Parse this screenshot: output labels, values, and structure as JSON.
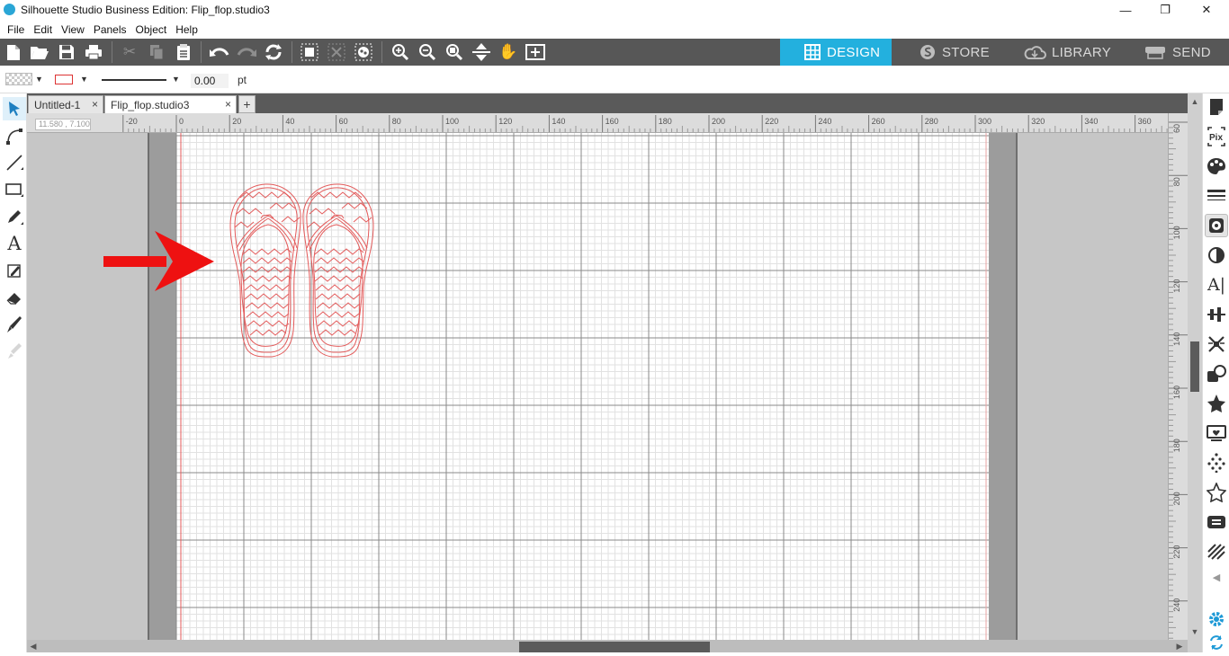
{
  "window": {
    "title": "Silhouette Studio Business Edition: Flip_flop.studio3",
    "controls": [
      "minimize",
      "restore",
      "close"
    ]
  },
  "menu": [
    "File",
    "Edit",
    "View",
    "Panels",
    "Object",
    "Help"
  ],
  "toolbar": {
    "file_icons": [
      "new-document-icon",
      "open-folder-icon",
      "save-icon",
      "print-icon"
    ],
    "edit_icons": [
      "cut-icon",
      "copy-icon",
      "paste-icon"
    ],
    "history_icons": [
      "undo-icon",
      "redo-icon",
      "redraw-icon"
    ],
    "group_icons": [
      "select-all-icon",
      "deselect-icon",
      "edit-points-icon"
    ],
    "zoom_icons": [
      "zoom-in-icon",
      "zoom-out-icon",
      "zoom-selection-icon",
      "fit-page-icon",
      "pan-hand-icon",
      "fit-to-window-icon"
    ],
    "nav_tabs": [
      {
        "label": "DESIGN",
        "icon": "grid-icon",
        "active": true
      },
      {
        "label": "STORE",
        "icon": "silhouette-s-icon",
        "active": false
      },
      {
        "label": "LIBRARY",
        "icon": "cloud-icon",
        "active": false
      },
      {
        "label": "SEND",
        "icon": "cutter-icon",
        "active": false
      }
    ],
    "active_color": "#23b0de"
  },
  "properties": {
    "fill_swatch": "transparent-checker",
    "line_color": "#dd3333",
    "line_weight": "0.00",
    "line_unit": "pt"
  },
  "left_tools": [
    "select-icon",
    "edit-points-icon",
    "line-icon",
    "rectangle-icon",
    "freehand-icon",
    "text-icon",
    "sketch-pen-icon",
    "eraser-icon",
    "knife-icon",
    "eyedropper-icon"
  ],
  "doc_tabs": [
    {
      "label": "Untitled-1",
      "active": false
    },
    {
      "label": "Flip_flop.studio3",
      "active": true
    }
  ],
  "add_tab_label": "+",
  "ruler": {
    "coord_readout": "11.580 , 7.100",
    "h_labels": [
      "-20",
      "0",
      "20",
      "40",
      "60",
      "80",
      "100",
      "120",
      "140",
      "160",
      "180",
      "200",
      "220",
      "240",
      "260",
      "280",
      "300",
      "320",
      "340",
      "360"
    ],
    "v_labels": [
      "60",
      "80",
      "100",
      "120",
      "140",
      "160",
      "180",
      "200",
      "220",
      "240"
    ]
  },
  "canvas": {
    "design_color": "#e35a5a",
    "annotation_arrow_color": "#ee1111",
    "objects": [
      "left-flip-flop",
      "right-flip-flop"
    ]
  },
  "right_panel": [
    "page-setup-icon",
    "pixscan-icon",
    "fill-panel-icon",
    "line-style-icon",
    "trace-icon",
    "transparency-icon",
    "text-style-icon",
    "align-icon",
    "replicate-icon",
    "modify-icon",
    "offset-icon",
    "transform-icon",
    "design-store-icon",
    "rhinestone-icon",
    "sketch-icon",
    "emboss-icon",
    "nesting-icon",
    "settings-gear-icon",
    "refresh-icon"
  ]
}
